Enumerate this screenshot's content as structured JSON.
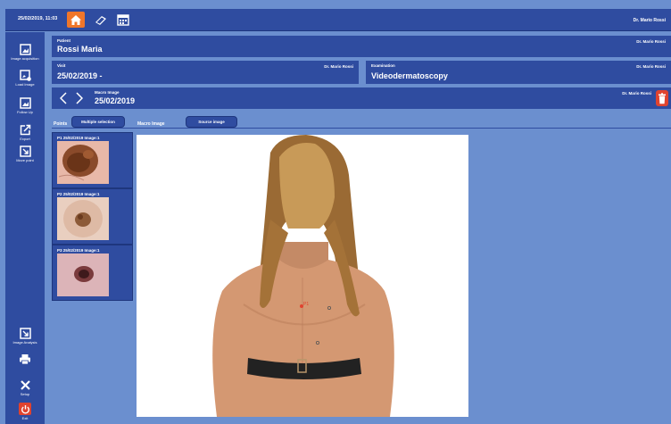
{
  "topbar": {
    "datetime": "25/02/2019, 11:03",
    "user": "Dr. Mario Rossi",
    "icons": [
      "home-icon",
      "book-icon",
      "calendar-icon"
    ]
  },
  "sidebar": {
    "items": [
      {
        "label": "Image acquisition",
        "icon": "camera-icon"
      },
      {
        "label": "Load Image",
        "icon": "load-image-icon"
      },
      {
        "label": "Follow Up",
        "icon": "follow-up-icon"
      },
      {
        "label": "Export",
        "icon": "export-icon"
      },
      {
        "label": "Move point",
        "icon": "move-point-icon"
      },
      {
        "label": "Image Analysis",
        "icon": "image-analysis-icon"
      },
      {
        "label": "",
        "icon": "print-icon"
      },
      {
        "label": "Setup",
        "icon": "setup-icon"
      },
      {
        "label": "Exit",
        "icon": "power-icon"
      }
    ]
  },
  "patient": {
    "label": "Patient",
    "name": "Rossi Maria",
    "doctor": "Dr. Mario Rossi"
  },
  "visit": {
    "label": "Visit",
    "value": "25/02/2019 -",
    "doctor": "Dr. Mario Rossi"
  },
  "examination": {
    "label": "Examination",
    "value": "Videodermatoscopy",
    "doctor": "Dr. Mario Rossi"
  },
  "macro": {
    "label": "Macro Image",
    "date": "25/02/2019",
    "doctor": "Dr. Mario Rossi"
  },
  "tabs": {
    "points": "Points",
    "multiple_selection": "Multiple selection",
    "macro_image": "Macro Image",
    "source_image": "Source image"
  },
  "points": [
    {
      "label": "P1  25/02/2019 Image:1"
    },
    {
      "label": "P2  25/02/2019 Image:1"
    },
    {
      "label": "P3  25/02/2019 Image:1"
    }
  ],
  "markers": [
    "P1",
    "",
    ""
  ],
  "colors": {
    "accent": "#2f4ca0",
    "background": "#6b8fcf",
    "home_orange": "#f0762a",
    "trash_red": "#e0432f"
  }
}
